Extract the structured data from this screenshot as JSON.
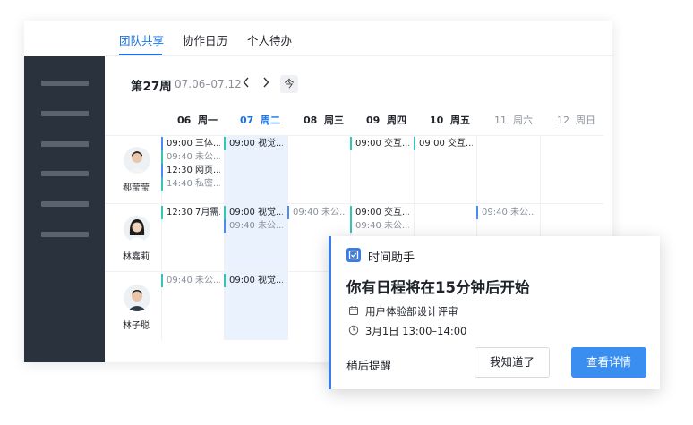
{
  "tabs": [
    {
      "label": "团队共享",
      "active": true
    },
    {
      "label": "协作日历",
      "active": false
    },
    {
      "label": "个人待办",
      "active": false
    }
  ],
  "week": {
    "label": "第27周",
    "range": "07.06–07.12",
    "prev_icon": "chevron-left-icon",
    "next_icon": "chevron-right-icon",
    "today_label": "今"
  },
  "days": [
    {
      "num": "06",
      "name": "周一"
    },
    {
      "num": "07",
      "name": "周二"
    },
    {
      "num": "08",
      "name": "周三"
    },
    {
      "num": "09",
      "name": "周四"
    },
    {
      "num": "10",
      "name": "周五"
    },
    {
      "num": "11",
      "name": "周六"
    },
    {
      "num": "12",
      "name": "周日"
    }
  ],
  "people": [
    {
      "name": "郝莹莹"
    },
    {
      "name": "林嘉莉"
    },
    {
      "name": "林子聪"
    }
  ],
  "events": {
    "r0_mon_1": "09:00 三体...",
    "r0_mon_2": "09:40 未公...",
    "r0_mon_3": "12:30 网页...",
    "r0_mon_4": "14:40 私密...",
    "r0_tue_1": "09:00 视觉...",
    "r0_thu_1": "09:00 交互...",
    "r0_fri_1": "09:00 交互...",
    "r1_mon_1": "12:30 7月需...",
    "r1_tue_1": "09:00 视觉...",
    "r1_tue_2": "09:40 未公...",
    "r1_wed_1": "09:40 未公...",
    "r1_thu_1": "09:00 交互...",
    "r1_thu_2": "09:40 未公...",
    "r1_sat_1": "09:40 未公...",
    "r2_mon_1": "09:40 未公...",
    "r2_tue_1": "09:00 视觉..."
  },
  "popup": {
    "icon": "checkbox-icon",
    "title": "时间助手",
    "heading": "你有日程将在15分钟后开始",
    "event_name": "用户体验部设计评审",
    "event_time": "3月1日  13:00–14:00",
    "snooze_label": "稍后提醒",
    "ack_label": "我知道了",
    "detail_label": "查看详情"
  },
  "colors": {
    "accent": "#1a73e8",
    "sidebar": "#2a333d",
    "primary_button": "#3a8ef0",
    "event_bar_blue": "#4c8bf5",
    "event_bar_teal": "#35c4b5",
    "today_column": "#eaf2fd"
  }
}
